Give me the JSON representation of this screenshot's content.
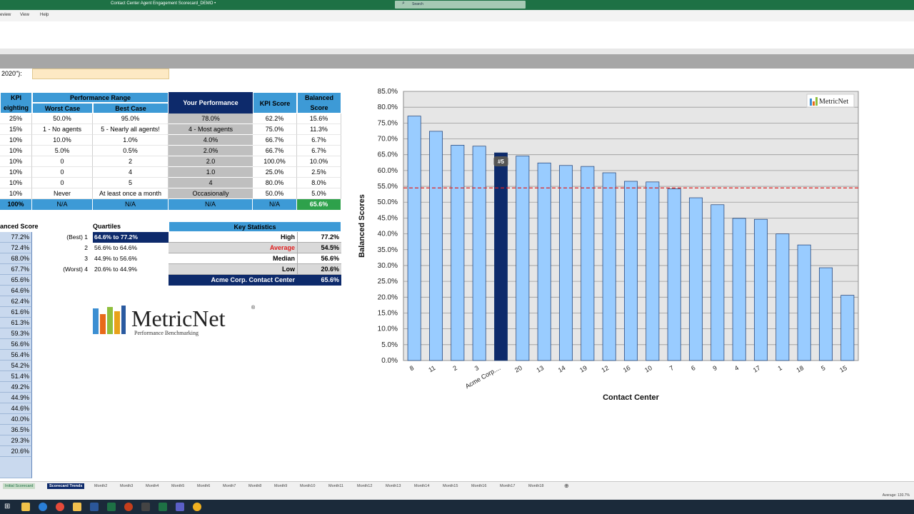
{
  "window": {
    "title": "Contact Center Agent Engagement Scorecard_DEMO  •",
    "search_placeholder": "Search"
  },
  "menu": [
    "eview",
    "View",
    "Help"
  ],
  "partial_label": "2020\"):",
  "kpi_table": {
    "headers": {
      "weighting": "KPI\neighting",
      "performance_range": "Performance Range",
      "worst": "Worst Case",
      "best": "Best Case",
      "your_perf": "Your Performance",
      "kpi_score": "KPI Score",
      "balanced": "Balanced\nScore"
    },
    "rows": [
      [
        "25%",
        "50.0%",
        "95.0%",
        "78.0%",
        "62.2%",
        "15.6%"
      ],
      [
        "15%",
        "1 - No agents",
        "5 - Nearly all agents!",
        "4 - Most agents",
        "75.0%",
        "11.3%"
      ],
      [
        "10%",
        "10.0%",
        "1.0%",
        "4.0%",
        "66.7%",
        "6.7%"
      ],
      [
        "10%",
        "5.0%",
        "0.5%",
        "2.0%",
        "66.7%",
        "6.7%"
      ],
      [
        "10%",
        "0",
        "2",
        "2.0",
        "100.0%",
        "10.0%"
      ],
      [
        "10%",
        "0",
        "4",
        "1.0",
        "25.0%",
        "2.5%"
      ],
      [
        "10%",
        "0",
        "5",
        "4",
        "80.0%",
        "8.0%"
      ],
      [
        "10%",
        "Never",
        "At least once a month",
        "Occasionally",
        "50.0%",
        "5.0%"
      ]
    ],
    "total": [
      "100%",
      "N/A",
      "N/A",
      "N/A",
      "N/A",
      "65.6%"
    ]
  },
  "balanced_list": {
    "header": "anced Score",
    "values": [
      "77.2%",
      "72.4%",
      "68.0%",
      "67.7%",
      "65.6%",
      "64.6%",
      "62.4%",
      "61.6%",
      "61.3%",
      "59.3%",
      "56.6%",
      "56.4%",
      "54.2%",
      "51.4%",
      "49.2%",
      "44.9%",
      "44.6%",
      "40.0%",
      "36.5%",
      "29.3%",
      "20.6%"
    ]
  },
  "quartiles": {
    "title": "Quartiles",
    "rows": [
      {
        "label": "(Best) 1",
        "range": "64.6% to 77.2%"
      },
      {
        "label": "2",
        "range": "56.6% to 64.6%"
      },
      {
        "label": "3",
        "range": "44.9% to 56.6%"
      },
      {
        "label": "(Worst) 4",
        "range": "20.6% to 44.9%"
      }
    ]
  },
  "key_stats": {
    "title": "Key Statistics",
    "rows": [
      {
        "label": "High",
        "value": "77.2%"
      },
      {
        "label": "Average",
        "value": "54.5%"
      },
      {
        "label": "Median",
        "value": "56.6%"
      },
      {
        "label": "Low",
        "value": "20.6%"
      }
    ],
    "footer_label": "Acme Corp. Contact Center",
    "footer_value": "65.6%"
  },
  "logo": {
    "name": "MetricNet",
    "tagline": "Performance Benchmarking",
    "reg": "®"
  },
  "chart_data": {
    "type": "bar",
    "categories": [
      "8",
      "11",
      "2",
      "3",
      "Acme Corp....",
      "20",
      "13",
      "14",
      "19",
      "12",
      "16",
      "10",
      "7",
      "6",
      "9",
      "4",
      "17",
      "1",
      "18",
      "5",
      "15"
    ],
    "values": [
      77.2,
      72.4,
      68.0,
      67.7,
      65.6,
      64.6,
      62.4,
      61.6,
      61.3,
      59.3,
      56.6,
      56.4,
      54.2,
      51.4,
      49.2,
      44.9,
      44.6,
      40.0,
      36.5,
      29.3,
      20.6
    ],
    "highlight_index": 4,
    "highlight_label": "#5",
    "average": 54.5,
    "xlabel": "Contact Center",
    "ylabel": "Balanced Scores",
    "ylim": [
      0,
      85
    ],
    "yticks": [
      "0.0%",
      "5.0%",
      "10.0%",
      "15.0%",
      "20.0%",
      "25.0%",
      "30.0%",
      "35.0%",
      "40.0%",
      "45.0%",
      "50.0%",
      "55.0%",
      "60.0%",
      "65.0%",
      "70.0%",
      "75.0%",
      "80.0%",
      "85.0%"
    ],
    "grid": true,
    "colors": {
      "bar": "#99ccff",
      "highlight": "#0d2a6b",
      "average": "#e02020",
      "plot_bg": "#e6e6e6"
    },
    "watermark": "MetricNet"
  },
  "tabs": [
    "Initial Scorecard",
    "Scorecard Trends",
    "Month2",
    "Month3",
    "Month4",
    "Month5",
    "Month6",
    "Month7",
    "Month8",
    "Month9",
    "Month10",
    "Month11",
    "Month12",
    "Month13",
    "Month14",
    "Month15",
    "Month16",
    "Month17",
    "Month18"
  ],
  "status": {
    "average": "Average: 130.7%"
  }
}
